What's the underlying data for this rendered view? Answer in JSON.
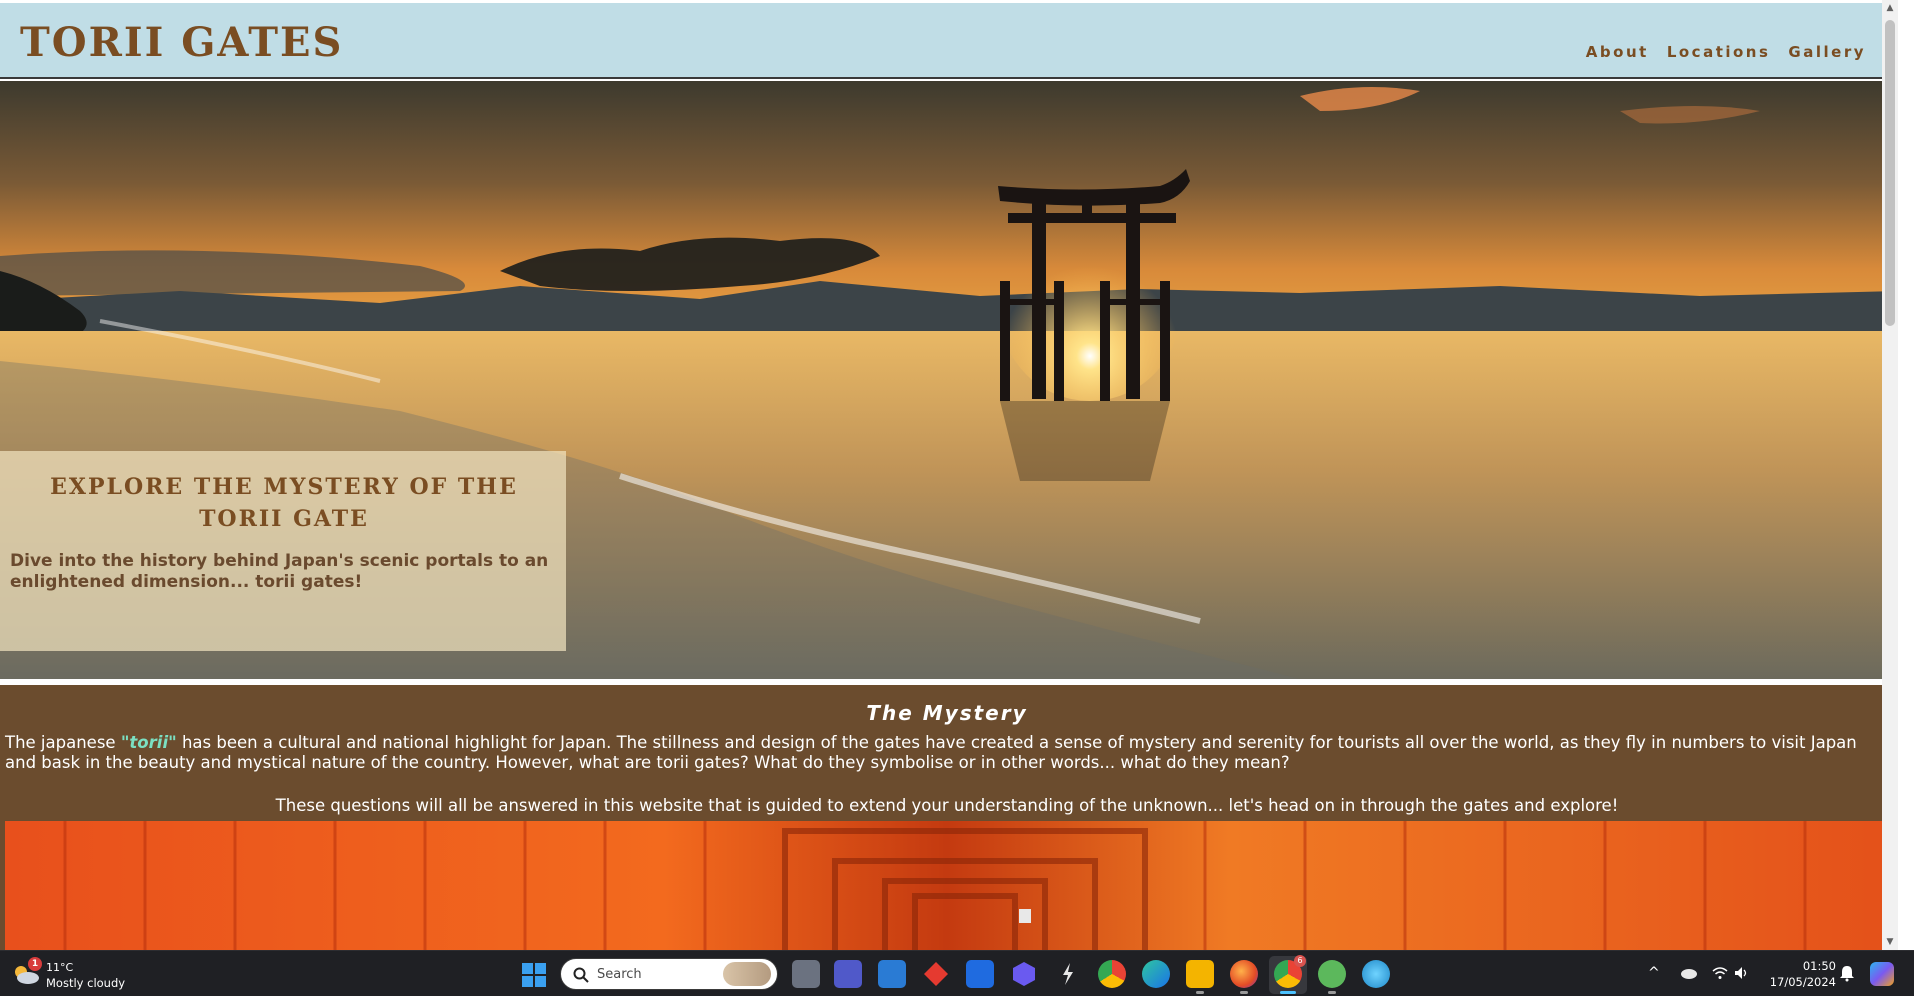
{
  "header": {
    "title": "TORII GATES",
    "nav": [
      "About",
      "Locations",
      "Gallery"
    ]
  },
  "hero": {
    "heading": "EXPLORE THE MYSTERY OF THE TORII GATE",
    "subheading": "Dive into the history behind Japan's scenic portals to an enlightened dimension... torii gates!"
  },
  "mystery": {
    "title": "The Mystery",
    "p1_before": "The japanese ",
    "p1_highlight": "\"torii\"",
    "p1_after": " has been a cultural and national highlight for Japan. The stillness and design of the gates have created a sense of mystery and serenity for tourists all over the world, as they fly in numbers to visit Japan and bask in the beauty and mystical nature of the country. However, what are torii gates? What do they symbolise or in other words... what do they mean?",
    "p2": "These questions will all be answered in this website that is guided to extend your understanding of the unknown... let's head on in through the gates and explore!"
  },
  "taskbar": {
    "weather": {
      "temp": "11°C",
      "condition": "Mostly cloudy",
      "badge": "1"
    },
    "search_placeholder": "Search",
    "apps": [
      "file-explorer-icon",
      "teams-icon",
      "store-icon",
      "red-app-icon",
      "dropbox-icon",
      "blue-app-icon",
      "dark-app-icon",
      "chrome-icon",
      "edge-icon",
      "folder-icon",
      "firefox-icon",
      "chrome-profile-icon",
      "utorrent-icon",
      "paint-icon"
    ],
    "chrome_badge": "6",
    "clock": {
      "time": "01:50",
      "date": "17/05/2024"
    }
  },
  "colors": {
    "header_bg": "#c0dde6",
    "brand_brown": "#7a4d22",
    "section_bg": "#6b4c2e",
    "highlight": "#7be0c2",
    "taskbar_bg": "#1f2024"
  }
}
